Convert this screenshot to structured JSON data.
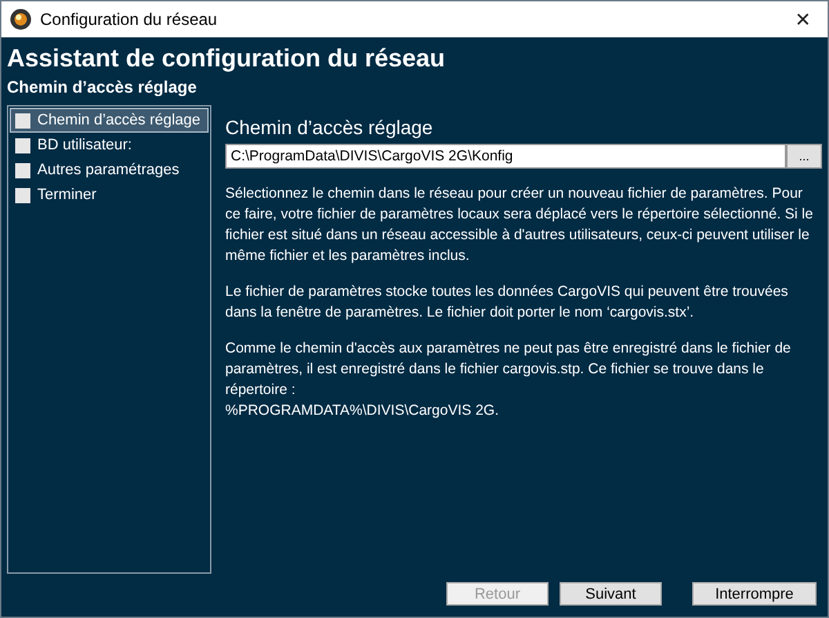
{
  "window": {
    "title": "Configuration du réseau",
    "close": "✕"
  },
  "header": {
    "title": "Assistant de configuration du réseau",
    "subtitle": "Chemin d’accès réglage"
  },
  "steps": [
    {
      "label": "Chemin d’accès réglage",
      "selected": true,
      "checked": false
    },
    {
      "label": "BD utilisateur:",
      "selected": false,
      "checked": false
    },
    {
      "label": "Autres paramétrages",
      "selected": false,
      "checked": false
    },
    {
      "label": "Terminer",
      "selected": false,
      "checked": false
    }
  ],
  "section": {
    "title": "Chemin d’accès réglage",
    "path": "C:\\ProgramData\\DIVIS\\CargoVIS 2G\\Konfig",
    "browse": "...",
    "paragraphs": [
      "Sélectionnez le chemin dans le réseau pour créer un nouveau fichier de paramètres. Pour ce faire, votre fichier de paramètres locaux sera déplacé vers le répertoire sélectionné. Si le fichier est situé dans un réseau accessible à d'autres utilisateurs, ceux-ci peuvent utiliser le même fichier et les paramètres inclus.",
      "Le fichier de paramètres stocke toutes les données CargoVIS qui peuvent être trouvées dans la fenêtre de paramètres. Le fichier doit porter le nom ‘cargovis.stx’.",
      "Comme le chemin d'accès aux paramètres ne peut pas être enregistré dans le fichier de paramètres, il est enregistré dans le fichier cargovis.stp. Ce fichier se trouve dans le répertoire :\n%PROGRAMDATA%\\DIVIS\\CargoVIS 2G."
    ]
  },
  "buttons": [
    {
      "label": "Retour",
      "disabled": true
    },
    {
      "label": "Suivant",
      "disabled": false
    },
    {
      "label": "Interrompre",
      "disabled": false
    }
  ]
}
